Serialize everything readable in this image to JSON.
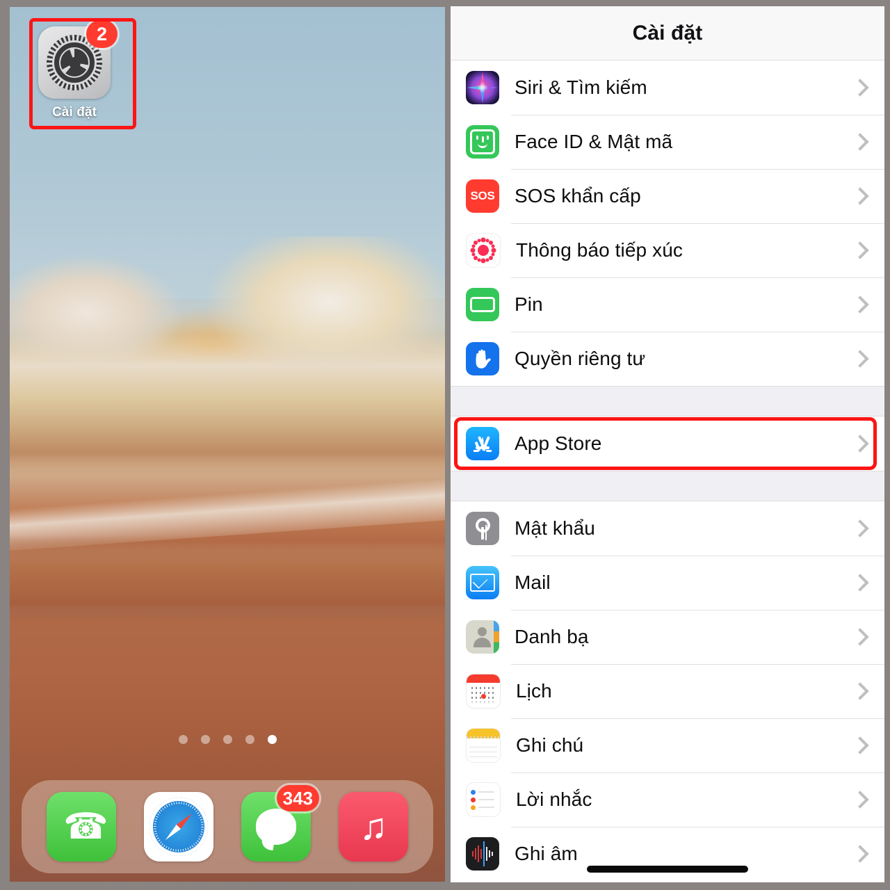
{
  "homescreen": {
    "app": {
      "name": "settings-app",
      "label": "Cài đặt",
      "badge": "2",
      "icon": "gear-icon",
      "highlighted": true
    },
    "page_dots": {
      "count": 5,
      "active_index": 4
    },
    "dock": [
      {
        "name": "phone-app",
        "label": "Phone",
        "icon": "phone-icon",
        "badge": null
      },
      {
        "name": "safari-app",
        "label": "Safari",
        "icon": "compass-icon",
        "badge": null
      },
      {
        "name": "messages-app",
        "label": "Messages",
        "icon": "speech-bubble-icon",
        "badge": "343"
      },
      {
        "name": "music-app",
        "label": "Music",
        "icon": "music-note-icon",
        "badge": null
      }
    ]
  },
  "settings": {
    "nav_title": "Cài đặt",
    "highlight_color": "#fb1515",
    "groups": [
      {
        "rows": [
          {
            "label": "Siri & Tìm kiếm",
            "icon": "siri-icon",
            "icon_class": "ic-siri",
            "highlight": false
          },
          {
            "label": "Face ID & Mật mã",
            "icon": "faceid-icon",
            "icon_class": "ic-faceid",
            "highlight": false
          },
          {
            "label": "SOS khẩn cấp",
            "icon": "sos-icon",
            "icon_class": "ic-sos",
            "highlight": false
          },
          {
            "label": "Thông báo tiếp xúc",
            "icon": "exposure-notification-icon",
            "icon_class": "ic-expo",
            "highlight": false
          },
          {
            "label": "Pin",
            "icon": "battery-icon",
            "icon_class": "ic-battery",
            "highlight": false
          },
          {
            "label": "Quyền riêng tư",
            "icon": "hand-privacy-icon",
            "icon_class": "ic-privacy",
            "highlight": false
          }
        ]
      },
      {
        "rows": [
          {
            "label": "App Store",
            "icon": "app-store-icon",
            "icon_class": "ic-appstore",
            "highlight": true
          }
        ]
      },
      {
        "rows": [
          {
            "label": "Mật khẩu",
            "icon": "key-icon",
            "icon_class": "ic-pass",
            "highlight": false
          },
          {
            "label": "Mail",
            "icon": "mail-envelope-icon",
            "icon_class": "ic-mail",
            "highlight": false
          },
          {
            "label": "Danh bạ",
            "icon": "contacts-icon",
            "icon_class": "ic-contacts",
            "highlight": false
          },
          {
            "label": "Lịch",
            "icon": "calendar-icon",
            "icon_class": "ic-cal",
            "highlight": false
          },
          {
            "label": "Ghi chú",
            "icon": "notes-icon",
            "icon_class": "ic-notes",
            "highlight": false
          },
          {
            "label": "Lời nhắc",
            "icon": "reminders-icon",
            "icon_class": "ic-remind",
            "highlight": false
          },
          {
            "label": "Ghi âm",
            "icon": "voice-memos-icon",
            "icon_class": "ic-voice",
            "highlight": false
          }
        ]
      }
    ]
  }
}
